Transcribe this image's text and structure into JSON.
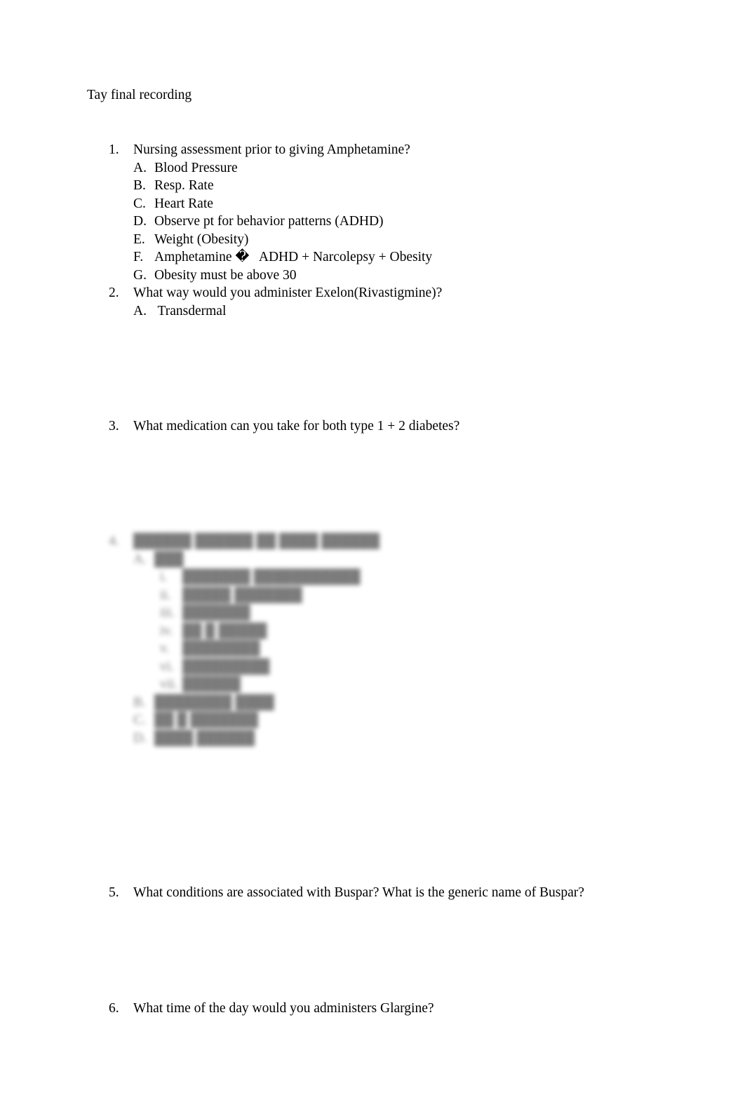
{
  "document": {
    "title": "Tay final recording",
    "background_color": "#ffffff",
    "text_color": "#000000"
  },
  "questions": [
    {
      "number": "1.",
      "text": "Nursing assessment prior to giving Amphetamine?",
      "answers": [
        {
          "marker": "A.",
          "text": "Blood Pressure"
        },
        {
          "marker": "B.",
          "text": "Resp. Rate"
        },
        {
          "marker": "C.",
          "text": "Heart Rate"
        },
        {
          "marker": "D.",
          "text": "Observe pt for behavior patterns (ADHD)"
        },
        {
          "marker": "E.",
          "text": "Weight (Obesity)"
        },
        {
          "marker": "F.",
          "text": "Amphetamine �   ADHD + Narcolepsy + Obesity"
        },
        {
          "marker": "G.",
          "text": "Obesity must be above 30"
        }
      ]
    },
    {
      "number": "2.",
      "text": "What way would you administer Exelon(Rivastigmine)?",
      "answers": [
        {
          "marker": "A.",
          "text": " Transdermal"
        }
      ]
    },
    {
      "number": "3.",
      "text": "What medication can you take for both type 1 + 2 diabetes?",
      "answers": []
    },
    {
      "number": "4.",
      "text": "██████ ██████ ██ ████ ██████",
      "redacted": true,
      "answers": [
        {
          "marker": "A.",
          "text": "███",
          "answers": [
            {
              "marker": "i.",
              "text": "███████ ███████████"
            },
            {
              "marker": "ii.",
              "text": "█████ ███████"
            },
            {
              "marker": "iii.",
              "text": "███████"
            },
            {
              "marker": "iv.",
              "text": "██ █ █████"
            },
            {
              "marker": "v.",
              "text": "████████"
            },
            {
              "marker": "vi.",
              "text": "█████████"
            },
            {
              "marker": "vii.",
              "text": "██████"
            }
          ]
        },
        {
          "marker": "B.",
          "text": "████████ ████"
        },
        {
          "marker": "C.",
          "text": "██ █ ███████"
        },
        {
          "marker": "D.",
          "text": "████ ██████"
        }
      ]
    },
    {
      "number": "5.",
      "text": "What conditions are associated with Buspar? What is the generic name of Buspar?",
      "answers": []
    },
    {
      "number": "6.",
      "text": "What time of the day would you administers Glargine?",
      "answers": []
    }
  ]
}
